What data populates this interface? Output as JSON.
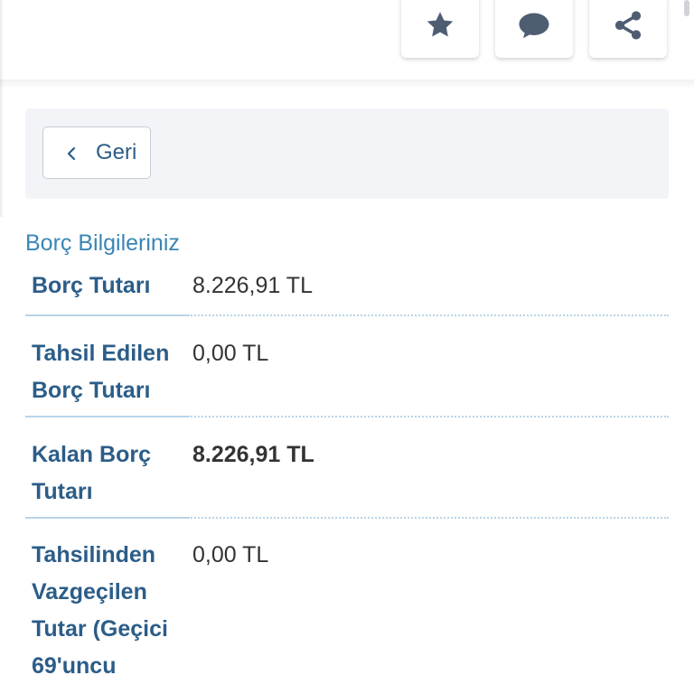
{
  "header": {
    "actions": [
      {
        "icon": "star-icon",
        "label": "favorite"
      },
      {
        "icon": "comment-icon",
        "label": "comment"
      },
      {
        "icon": "share-icon",
        "label": "share"
      }
    ]
  },
  "nav": {
    "back_label": "Geri"
  },
  "debt_section": {
    "title": "Borç Bilgileriniz",
    "rows": [
      {
        "label": "Borç Tutarı",
        "value": "8.226,91 TL"
      },
      {
        "label": "Tahsil Edilen Borç Tutarı",
        "value": "0,00 TL"
      },
      {
        "label": "Kalan Borç Tutarı",
        "value": "8.226,91 TL"
      },
      {
        "label": "Tahsilinden Vazgeçilen Tutar (Geçici 69'uncu",
        "value": "0,00 TL"
      }
    ]
  },
  "colors": {
    "label_color": "#2b5d88",
    "title_color": "#3a86b5",
    "value_color": "#333333",
    "divider_color": "#b8d4e8",
    "panel_bg": "#f2f4f7",
    "icon_color": "#4f5d73"
  }
}
